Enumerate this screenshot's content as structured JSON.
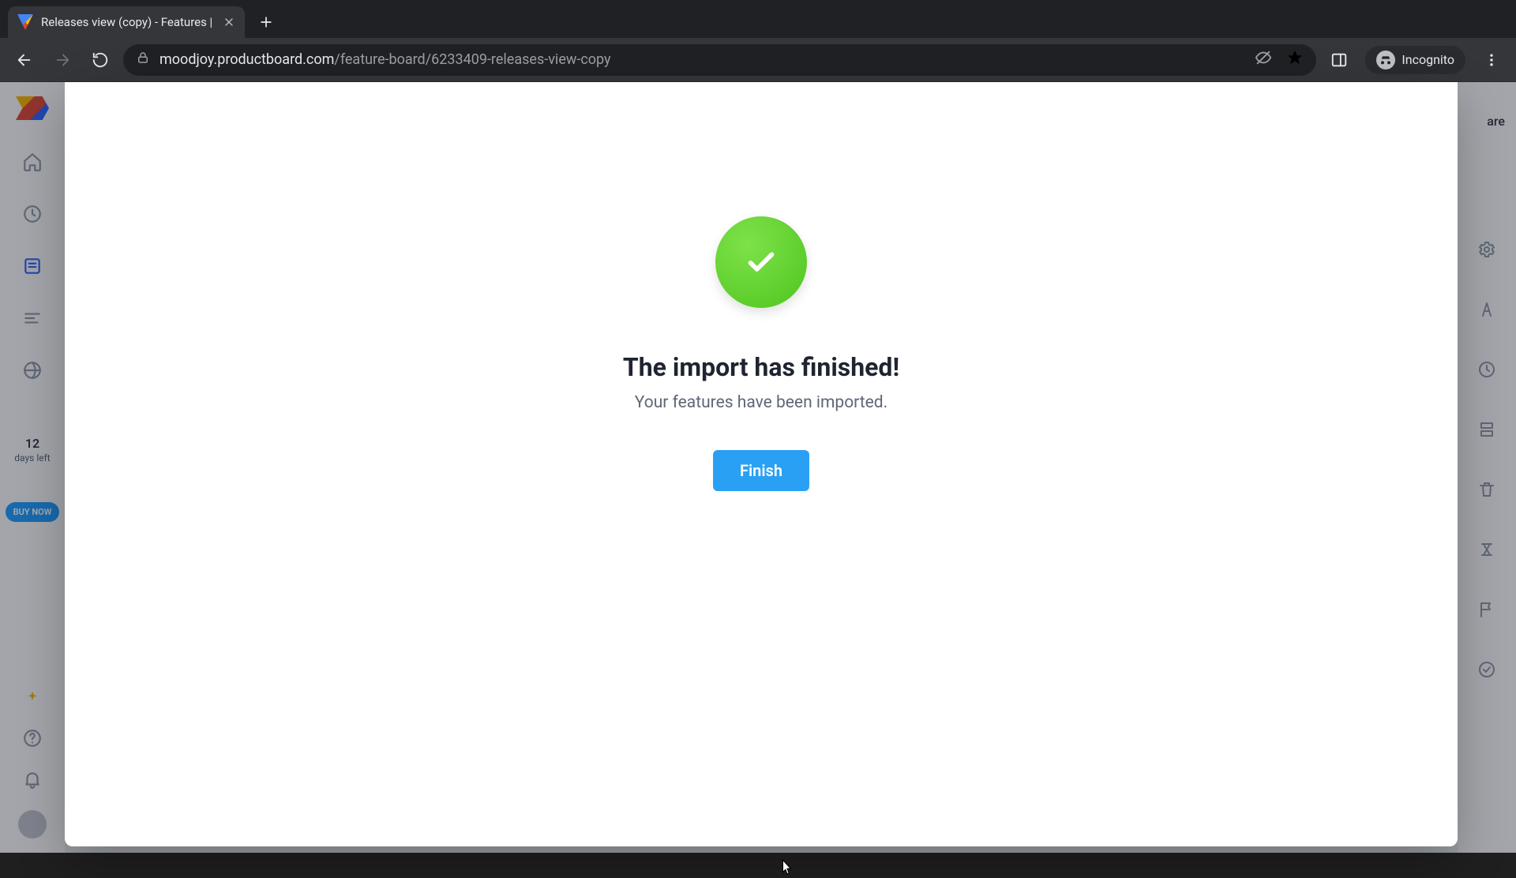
{
  "tab": {
    "title": "Releases view (copy) - Features |"
  },
  "url": {
    "host": "moodjoy.productboard.com",
    "path": "/feature-board/6233409-releases-view-copy"
  },
  "incognito": {
    "label": "Incognito"
  },
  "left_rail": {
    "trial": {
      "count": "12",
      "caption": "days left"
    },
    "buy_label": "BUY NOW"
  },
  "right_rail": {
    "share_stub": "are"
  },
  "modal": {
    "heading": "The import has finished!",
    "subtext": "Your features have been imported.",
    "finish_label": "Finish"
  }
}
